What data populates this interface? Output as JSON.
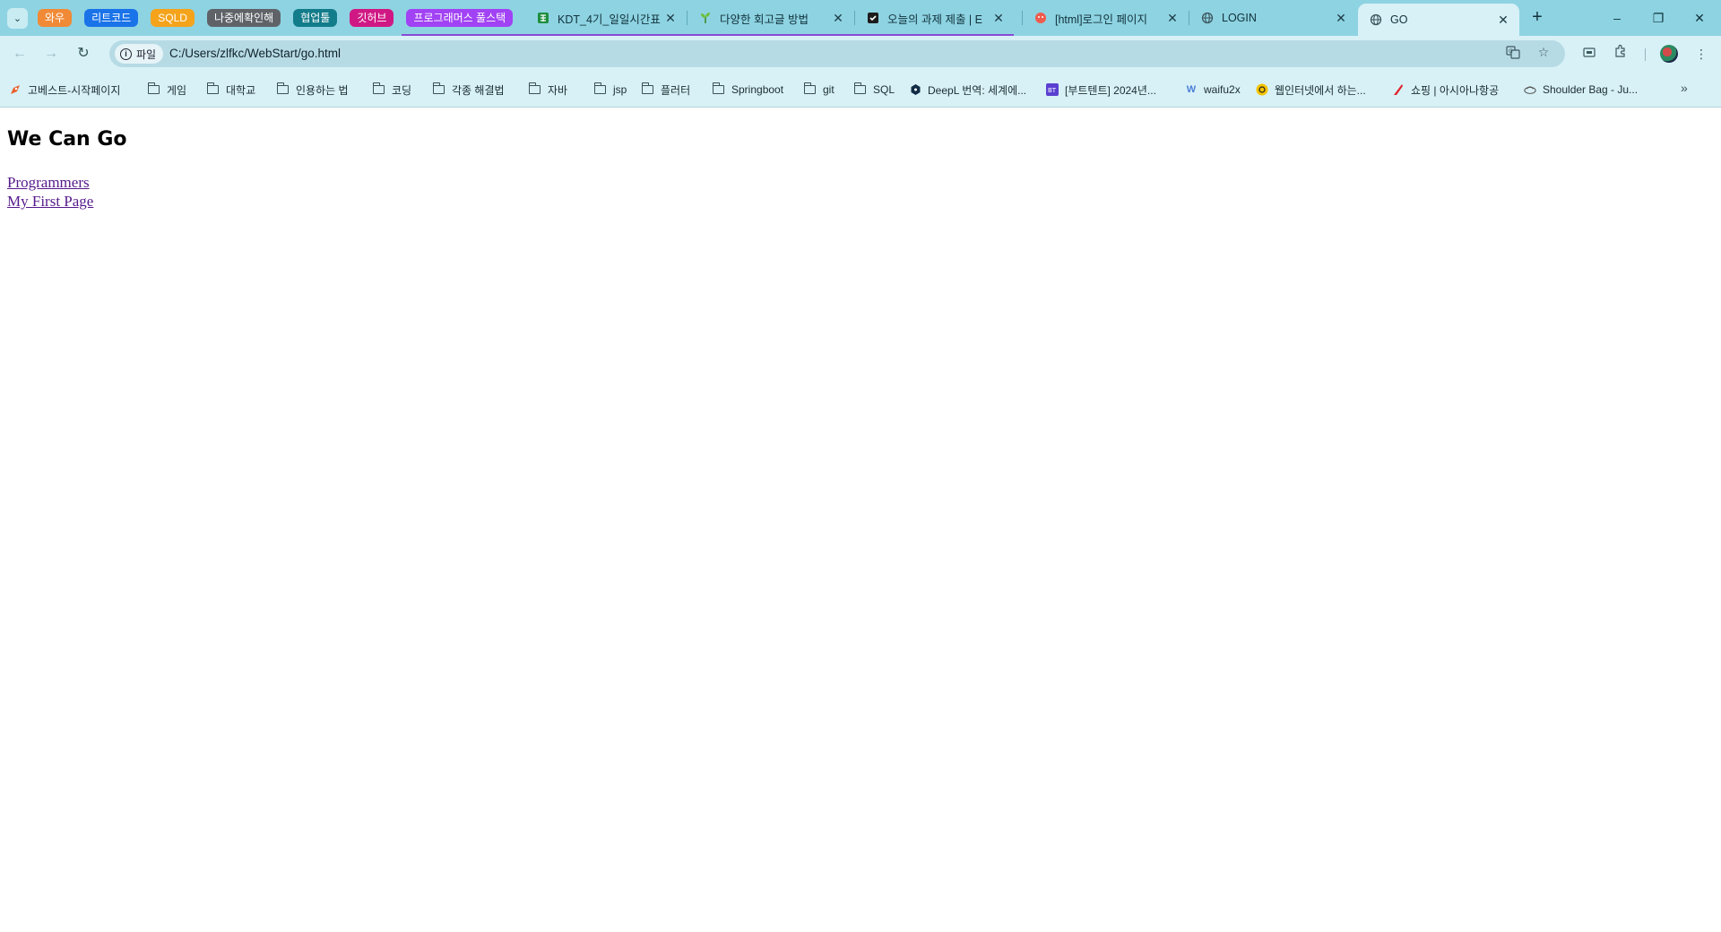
{
  "tab_groups": [
    {
      "label": "와우",
      "color": "#f08a36"
    },
    {
      "label": "리트코드",
      "color": "#1a73e8"
    },
    {
      "label": "SQLD",
      "color": "#f4a31b"
    },
    {
      "label": "나중에확인해",
      "color": "#5f6368"
    },
    {
      "label": "협업툴",
      "color": "#137c8a"
    },
    {
      "label": "깃허브",
      "color": "#d01884"
    },
    {
      "label": "프로그래머스 풀스택",
      "color": "#a142f4"
    }
  ],
  "tabs": [
    {
      "title": "KDT_4기_일일시간표",
      "favicon": "spreadsheet-icon"
    },
    {
      "title": "다양한 회고글 방법",
      "favicon": "sprout-icon"
    },
    {
      "title": "오늘의 과제 제출 | E",
      "favicon": "checkmark-icon"
    },
    {
      "title": "[html]로그인 페이지",
      "favicon": "cat-face-icon"
    },
    {
      "title": "LOGIN",
      "favicon": "globe-icon"
    },
    {
      "title": "GO",
      "favicon": "globe-icon",
      "active": true
    }
  ],
  "window_controls": {
    "minimize": "–",
    "restore": "❐",
    "close": "✕"
  },
  "toolbar": {
    "file_chip_label": "파일",
    "url": "C:/Users/zlfkc/WebStart/go.html"
  },
  "bookmarks": [
    {
      "label": "고베스트-시작페이지",
      "icon": "rocket-icon"
    },
    {
      "label": "게임",
      "icon": "folder-icon"
    },
    {
      "label": "대학교",
      "icon": "folder-icon"
    },
    {
      "label": "인용하는 법",
      "icon": "folder-icon"
    },
    {
      "label": "코딩",
      "icon": "folder-icon"
    },
    {
      "label": "각종 해결법",
      "icon": "folder-icon"
    },
    {
      "label": "자바",
      "icon": "folder-icon"
    },
    {
      "label": "jsp",
      "icon": "folder-icon"
    },
    {
      "label": "플러터",
      "icon": "folder-icon"
    },
    {
      "label": "Springboot",
      "icon": "folder-icon"
    },
    {
      "label": "git",
      "icon": "folder-icon"
    },
    {
      "label": "SQL",
      "icon": "folder-icon"
    },
    {
      "label": "DeepL 번역: 세계에...",
      "icon": "deepl-icon"
    },
    {
      "label": "[부트텐트] 2024년...",
      "icon": "boottent-icon"
    },
    {
      "label": "waifu2x",
      "icon": "w-icon"
    },
    {
      "label": "웹인터넷에서 하는...",
      "icon": "smile-icon"
    },
    {
      "label": "쇼핑 | 아시아나항공",
      "icon": "asiana-icon"
    },
    {
      "label": "Shoulder Bag - Ju...",
      "icon": "bag-icon"
    }
  ],
  "page": {
    "heading": "We Can Go",
    "links": [
      "Programmers",
      "My First Page"
    ]
  }
}
